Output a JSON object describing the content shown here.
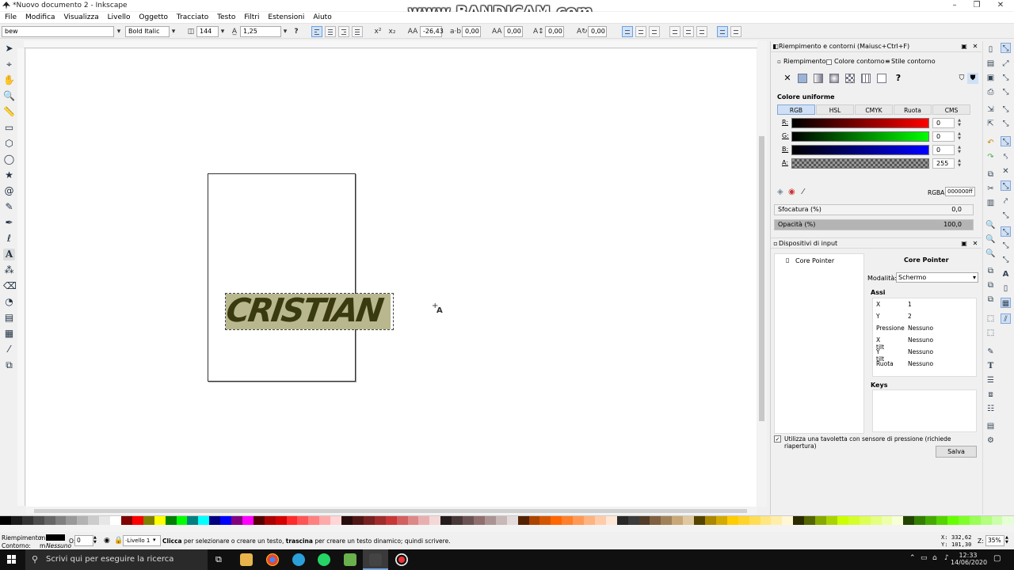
{
  "window": {
    "title": "*Nuovo documento 2 - Inkscape",
    "watermark": "www.BANDICAM.com"
  },
  "menu": [
    "File",
    "Modifica",
    "Visualizza",
    "Livello",
    "Oggetto",
    "Tracciato",
    "Testo",
    "Filtri",
    "Estensioni",
    "Aiuto"
  ],
  "text_toolbar": {
    "font_family": "bew",
    "font_style": "Bold Italic",
    "font_size": "144",
    "line_spacing": "1,25",
    "letter_spacing": "-26,43",
    "word_spacing": "0,00",
    "kerning": "0,00",
    "vertical_shift": "0,00",
    "rotation": "0,00"
  },
  "canvas": {
    "text": "CRISTIAN",
    "cursor_glyph": "A"
  },
  "fill_panel": {
    "title": "Riempimento e contorni (Maiusc+Ctrl+F)",
    "tabs": [
      "Riempimento",
      "Colore contorno",
      "Stile contorno"
    ],
    "color_mode_label": "Colore uniforme",
    "color_modes": [
      "RGB",
      "HSL",
      "CMYK",
      "Ruota",
      "CMS"
    ],
    "channels": [
      {
        "label": "R:",
        "value": "0",
        "gradient": "linear-gradient(to right,#000,#f00)"
      },
      {
        "label": "G:",
        "value": "0",
        "gradient": "linear-gradient(to right,#000,#0f0)"
      },
      {
        "label": "B:",
        "value": "0",
        "gradient": "linear-gradient(to right,#000,#00f)"
      },
      {
        "label": "A:",
        "value": "255",
        "gradient": "repeating-conic-gradient(#555 0 25%,#999 0 50%) 0 0/6px 6px"
      }
    ],
    "rgba_label": "RGBA:",
    "rgba_value": "000000ff",
    "blur_label": "Sfocatura (%)",
    "blur_value": "0,0",
    "opacity_label": "Opacità (%)",
    "opacity_value": "100,0"
  },
  "input_panel": {
    "title": "Dispositivi di input",
    "device": "Core Pointer",
    "heading": "Core Pointer",
    "mode_label": "Modalità:",
    "mode_value": "Schermo",
    "axes_label": "Assi",
    "axes": [
      {
        "k": "X",
        "v": "1"
      },
      {
        "k": "Y",
        "v": "2"
      },
      {
        "k": "Pressione",
        "v": "Nessuno"
      },
      {
        "k": "X tilt",
        "v": "Nessuno"
      },
      {
        "k": "Y tilt",
        "v": "Nessuno"
      },
      {
        "k": "Ruota",
        "v": "Nessuno"
      }
    ],
    "keys_label": "Keys",
    "tablet_label": "Utilizza una tavoletta con sensore di pressione (richiede riapertura)",
    "save_label": "Salva"
  },
  "palette_colors": [
    "#000000",
    "#1a1a1a",
    "#333333",
    "#4d4d4d",
    "#666666",
    "#808080",
    "#999999",
    "#b3b3b3",
    "#cccccc",
    "#e6e6e6",
    "#ffffff",
    "#800000",
    "#ff0000",
    "#808000",
    "#ffff00",
    "#008000",
    "#00ff00",
    "#008080",
    "#00ffff",
    "#000080",
    "#0000ff",
    "#800080",
    "#ff00ff",
    "#550000",
    "#aa0000",
    "#d40000",
    "#ff2a2a",
    "#ff5555",
    "#ff8080",
    "#ffaaaa",
    "#ffd5d5",
    "#280b0b",
    "#501616",
    "#782121",
    "#a02c2c",
    "#c83737",
    "#d35f5f",
    "#de8787",
    "#e9afaf",
    "#f4d7d7",
    "#241c1c",
    "#483737",
    "#6c5353",
    "#916f6f",
    "#ac9393",
    "#c8b7b7",
    "#e3dbdb",
    "#552200",
    "#aa4400",
    "#d45500",
    "#ff6600",
    "#ff7f2a",
    "#ff9955",
    "#ffb380",
    "#ffccaa",
    "#ffe6d5",
    "#282828",
    "#3c3c3c",
    "#503c28",
    "#806040",
    "#a0825a",
    "#c8a878",
    "#e0c8a0",
    "#554400",
    "#aa8800",
    "#d4aa00",
    "#ffcc00",
    "#ffd42a",
    "#ffdd55",
    "#ffe680",
    "#ffeeaa",
    "#fff6d5",
    "#2b2b00",
    "#556600",
    "#88aa00",
    "#aad400",
    "#ccff00",
    "#d4ff2a",
    "#ddff55",
    "#e5ff80",
    "#eeffaa",
    "#f6ffd5",
    "#224400",
    "#338000",
    "#44aa00",
    "#55d400",
    "#66ff00",
    "#7fff2a",
    "#99ff55",
    "#b3ff80",
    "#ccffaa",
    "#e5ffd5"
  ],
  "status": {
    "fill_label": "Riempimento:",
    "fill_value": "m",
    "stroke_label": "Contorno:",
    "stroke_value": "m",
    "stroke_none": "Nessuno",
    "opacity_label": "O:",
    "opacity_value": "0",
    "layer": "·Livello 1",
    "message_b1": "Clicca",
    "message_t1": " per selezionare o creare un testo, ",
    "message_b2": "trascina",
    "message_t2": " per creare un testo dinamico; quindi scrivere.",
    "x_label": "X:",
    "x_value": "332,62",
    "y_label": "Y:",
    "y_value": "101,30",
    "z_label": "Z:",
    "zoom": "35%"
  },
  "taskbar": {
    "search_placeholder": "Scrivi qui per eseguire la ricerca",
    "time": "12:33",
    "date": "14/06/2020"
  }
}
